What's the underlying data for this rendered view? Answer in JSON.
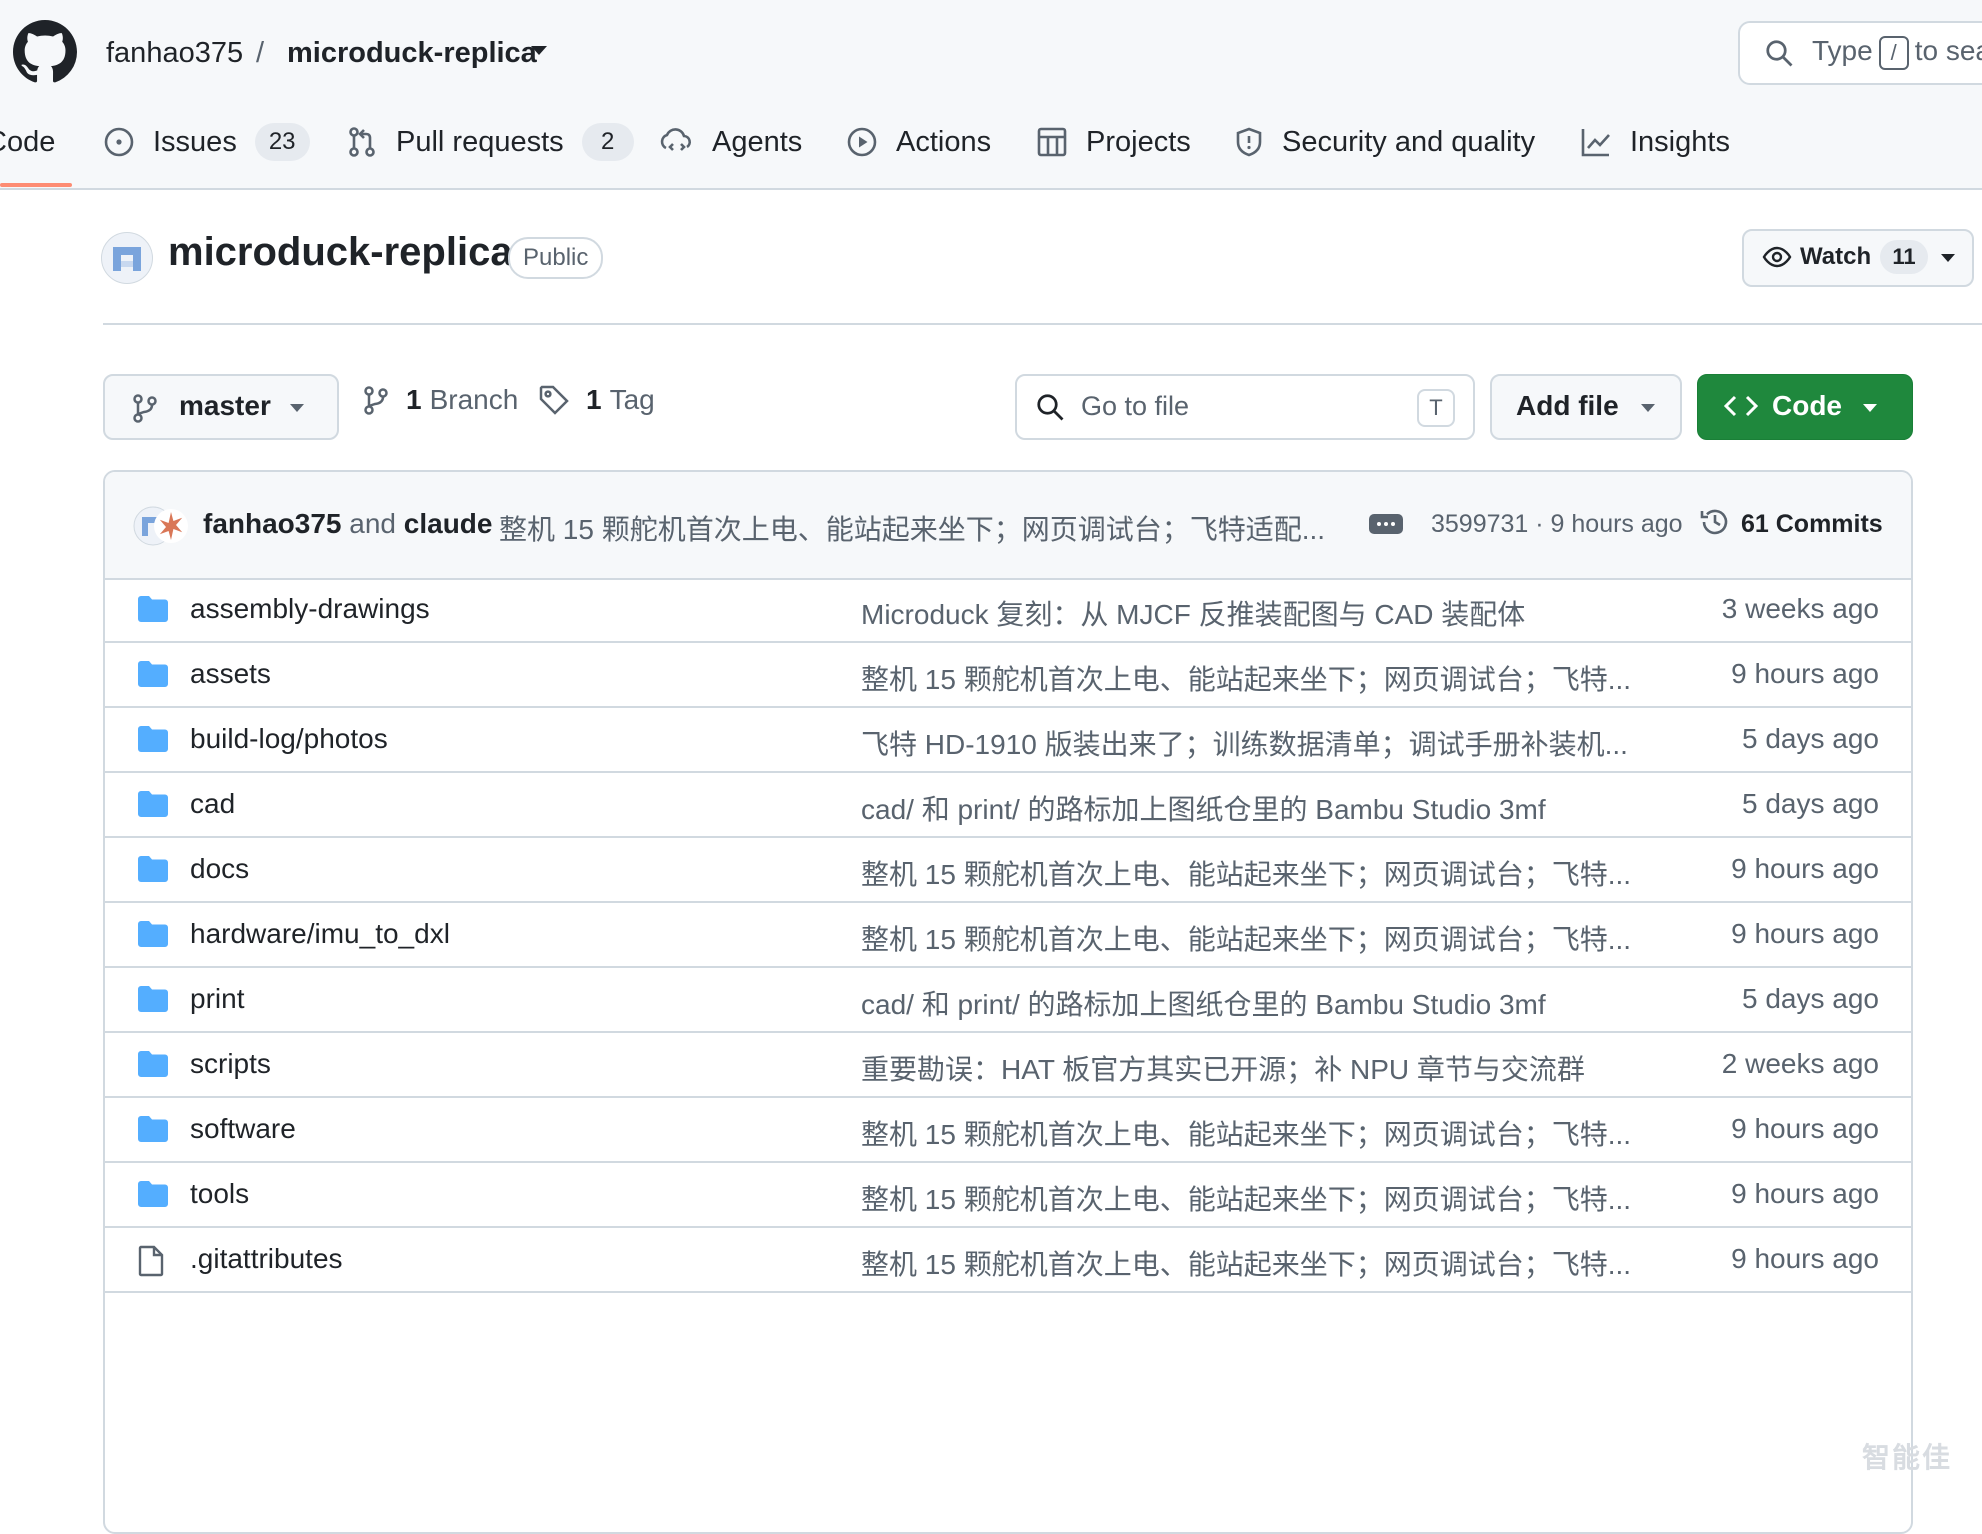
{
  "header": {
    "owner": "fanhao375",
    "separator": "/",
    "repo": "microduck-replica",
    "search_prefix": "Type",
    "search_kbd": "/",
    "search_suffix": "to sea"
  },
  "tabs": [
    {
      "label": "Code",
      "icon": "code-icon",
      "active": true
    },
    {
      "label": "Issues",
      "icon": "issue-opened-icon",
      "count": "23"
    },
    {
      "label": "Pull requests",
      "icon": "git-pull-request-icon",
      "count": "2"
    },
    {
      "label": "Agents",
      "icon": "agents-icon"
    },
    {
      "label": "Actions",
      "icon": "play-icon"
    },
    {
      "label": "Projects",
      "icon": "table-icon"
    },
    {
      "label": "Security and quality",
      "icon": "shield-icon"
    },
    {
      "label": "Insights",
      "icon": "graph-icon"
    }
  ],
  "repo": {
    "title": "microduck-replica",
    "visibility": "Public",
    "watch_label": "Watch",
    "watch_count": "11"
  },
  "toolbar": {
    "branch": "master",
    "branches_count": "1",
    "branches_label": "Branch",
    "tags_count": "1",
    "tags_label": "Tag",
    "goto_placeholder": "Go to file",
    "goto_kbd": "T",
    "add_file_label": "Add file",
    "code_label": "Code"
  },
  "latest_commit": {
    "author1": "fanhao375",
    "and": "and",
    "author2": "claude",
    "message": "整机 15 颗舵机首次上电、能站起来坐下；网页调试台；飞特适配...",
    "hash_time": "3599731 · 9 hours ago",
    "commits_label": "61 Commits"
  },
  "files": [
    {
      "name": "assembly-drawings",
      "type": "dir",
      "message": "Microduck 复刻：从 MJCF 反推装配图与 CAD 装配体",
      "time": "3 weeks ago"
    },
    {
      "name": "assets",
      "type": "dir",
      "message": "整机 15 颗舵机首次上电、能站起来坐下；网页调试台；飞特...",
      "time": "9 hours ago"
    },
    {
      "name": "build-log/photos",
      "type": "dir",
      "message": "飞特 HD-1910 版装出来了；训练数据清单；调试手册补装机...",
      "time": "5 days ago"
    },
    {
      "name": "cad",
      "type": "dir",
      "message": "cad/ 和 print/ 的路标加上图纸仓里的 Bambu Studio 3mf",
      "time": "5 days ago"
    },
    {
      "name": "docs",
      "type": "dir",
      "message": "整机 15 颗舵机首次上电、能站起来坐下；网页调试台；飞特...",
      "time": "9 hours ago"
    },
    {
      "name": "hardware/imu_to_dxl",
      "type": "dir",
      "message": "整机 15 颗舵机首次上电、能站起来坐下；网页调试台；飞特...",
      "time": "9 hours ago"
    },
    {
      "name": "print",
      "type": "dir",
      "message": "cad/ 和 print/ 的路标加上图纸仓里的 Bambu Studio 3mf",
      "time": "5 days ago"
    },
    {
      "name": "scripts",
      "type": "dir",
      "message": "重要勘误：HAT 板官方其实已开源；补 NPU 章节与交流群",
      "time": "2 weeks ago"
    },
    {
      "name": "software",
      "type": "dir",
      "message": "整机 15 颗舵机首次上电、能站起来坐下；网页调试台；飞特...",
      "time": "9 hours ago"
    },
    {
      "name": "tools",
      "type": "dir",
      "message": "整机 15 颗舵机首次上电、能站起来坐下；网页调试台；飞特...",
      "time": "9 hours ago"
    },
    {
      "name": ".gitattributes",
      "type": "file",
      "message": "整机 15 颗舵机首次上电、能站起来坐下；网页调试台；飞特...",
      "time": "9 hours ago"
    }
  ],
  "watermark": "智能佳",
  "colors": {
    "header_bg": "#f6f8fa",
    "border": "#d1d9e0",
    "active_tab_underline": "#fd8c73",
    "code_button": "#1f883d",
    "folder_icon": "#54aeff",
    "muted_text": "#59636e"
  }
}
